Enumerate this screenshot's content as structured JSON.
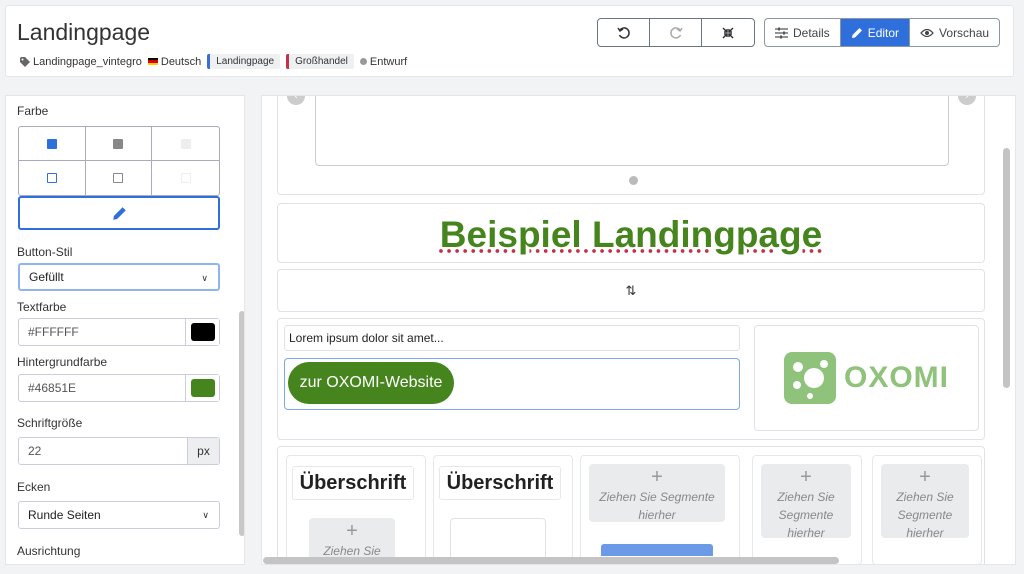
{
  "header": {
    "title": "Landingpage",
    "tags": {
      "project": "Landingpage_vintegro",
      "language": "Deutsch",
      "pill1": "Landingpage",
      "pill2": "Großhandel",
      "status": "Entwurf"
    },
    "view_buttons": {
      "details": "Details",
      "editor": "Editor",
      "preview": "Vorschau"
    },
    "accent": "#2f6fdb"
  },
  "sidebar": {
    "color_label": "Farbe",
    "button_style_label": "Button-Stil",
    "button_style_value": "Gefüllt",
    "text_color_label": "Textfarbe",
    "text_color_value": "#FFFFFF",
    "bg_color_label": "Hintergrundfarbe",
    "bg_color_value": "#46851E",
    "font_size_label": "Schriftgröße",
    "font_size_value": "22",
    "font_size_unit": "px",
    "corners_label": "Ecken",
    "corners_value": "Runde Seiten",
    "alignment_label": "Ausrichtung"
  },
  "canvas": {
    "headline": "Beispiel Landingpage",
    "lorem": "Lorem ipsum dolor sit amet...",
    "cta": "zur OXOMI-Website",
    "logo_text": "OXOMI",
    "col_title_1": "Überschrift",
    "col_title_2": "Überschrift",
    "drop_text": "Ziehen Sie Segmente hierher",
    "drop_text_partial": "Ziehen Sie",
    "brand_green": "#46851e"
  }
}
